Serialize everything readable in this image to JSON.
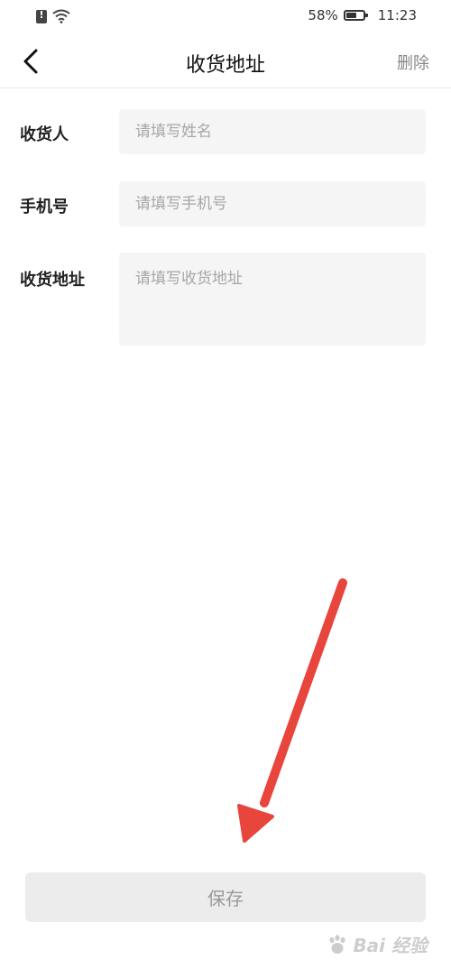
{
  "status_bar": {
    "battery_percent": "58%",
    "time": "11:23",
    "icons": [
      "sim-alert-icon",
      "wifi-icon",
      "battery-icon"
    ]
  },
  "nav": {
    "title": "收货地址",
    "delete_label": "删除",
    "back_icon": "chevron-left-icon"
  },
  "form": {
    "name": {
      "label": "收货人",
      "placeholder": "请填写姓名",
      "value": ""
    },
    "phone": {
      "label": "手机号",
      "placeholder": "请填写手机号",
      "value": ""
    },
    "address": {
      "label": "收货地址",
      "placeholder": "请填写收货地址",
      "value": ""
    }
  },
  "save_label": "保存",
  "annotation": {
    "arrow_color": "#e8453c"
  },
  "watermark": {
    "text": "Bai  经验",
    "icon": "baidu-paw-icon"
  }
}
